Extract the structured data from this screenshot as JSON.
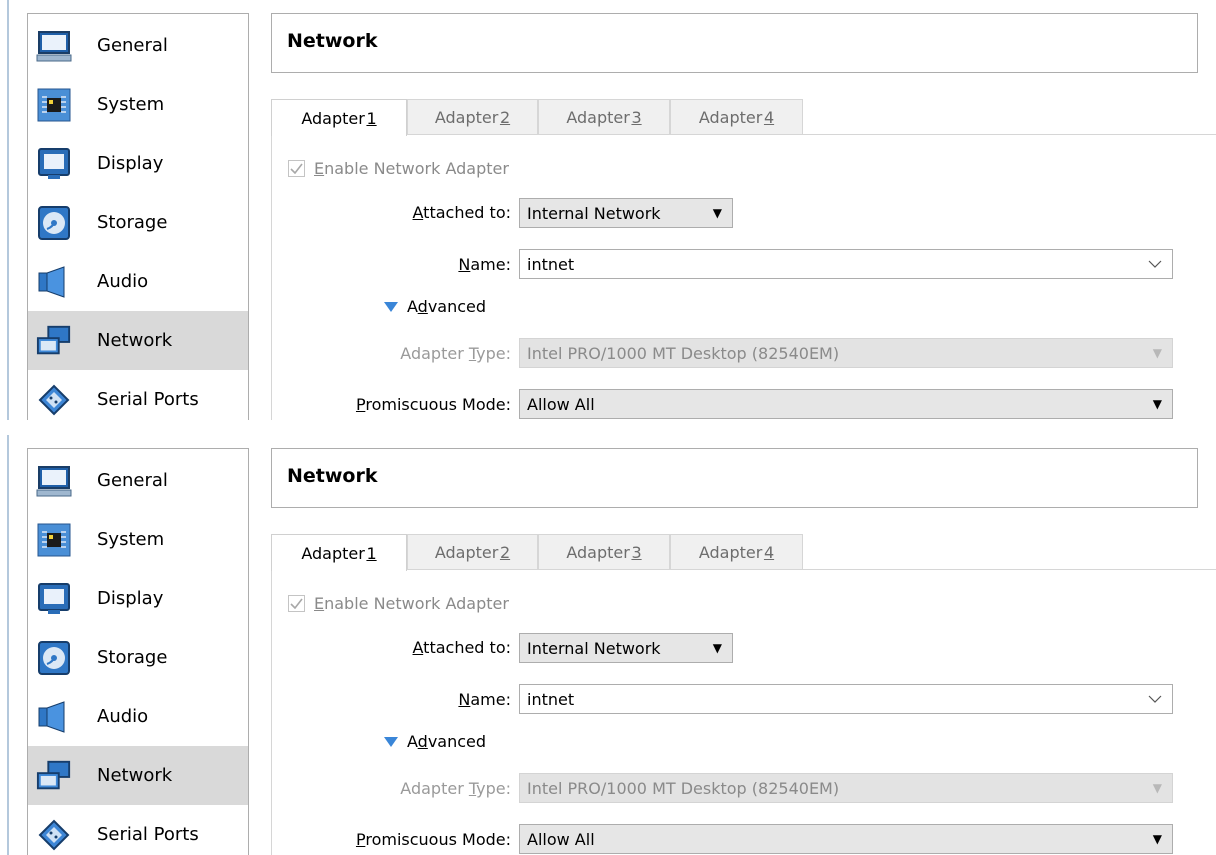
{
  "sidebar": {
    "items": [
      {
        "label": "General",
        "icon": "monitor-icon"
      },
      {
        "label": "System",
        "icon": "chip-icon"
      },
      {
        "label": "Display",
        "icon": "display-icon"
      },
      {
        "label": "Storage",
        "icon": "disc-icon"
      },
      {
        "label": "Audio",
        "icon": "speaker-icon"
      },
      {
        "label": "Network",
        "icon": "network-icon"
      },
      {
        "label": "Serial Ports",
        "icon": "serial-port-icon"
      }
    ],
    "active": "Network"
  },
  "header": {
    "title": "Network"
  },
  "tabs": [
    {
      "prefix": "Adapter ",
      "key": "1"
    },
    {
      "prefix": "Adapter ",
      "key": "2"
    },
    {
      "prefix": "Adapter ",
      "key": "3"
    },
    {
      "prefix": "Adapter ",
      "key": "4"
    }
  ],
  "form": {
    "enable_adapter": {
      "key": "E",
      "rest": "nable Network Adapter",
      "checked": true
    },
    "attached_to": {
      "label_key": "A",
      "label_rest": "ttached to:",
      "value": "Internal Network"
    },
    "name": {
      "label_key": "N",
      "label_rest": "ame:",
      "value": "intnet"
    },
    "advanced": {
      "pre": "A",
      "key": "d",
      "rest": "vanced"
    },
    "adapter_type": {
      "label_pre": "Adapter ",
      "label_key": "T",
      "label_rest": "ype:",
      "value": "Intel PRO/1000 MT Desktop (82540EM)"
    },
    "promiscuous_mode": {
      "label_key": "P",
      "label_rest": "romiscuous Mode:",
      "value": "Allow All"
    }
  },
  "colors": {
    "accent": "#3a86d8",
    "active_bg": "#d9d9d9",
    "border": "#adadad"
  }
}
